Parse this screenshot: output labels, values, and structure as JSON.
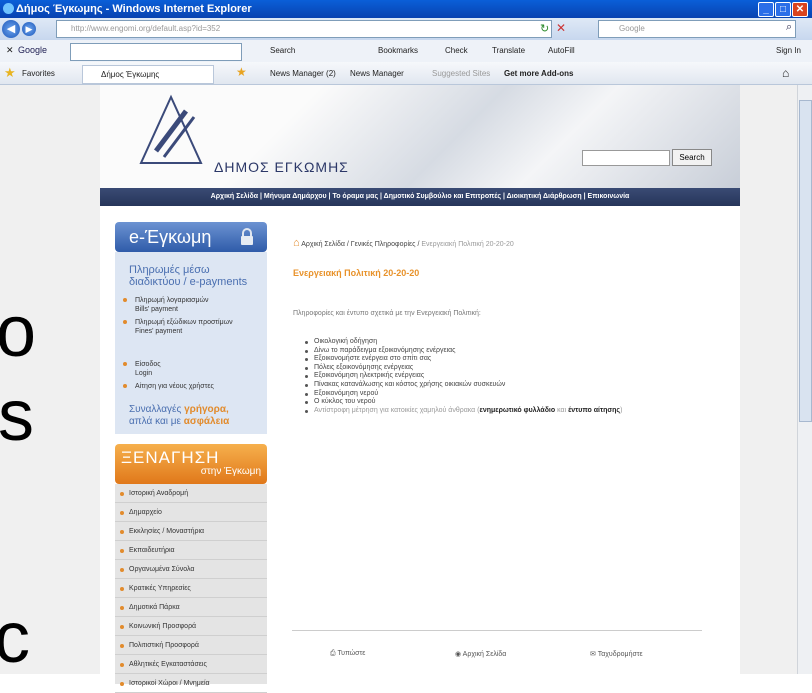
{
  "window": {
    "title": "Δήμος Έγκωμης - Windows Internet Explorer",
    "buttons": [
      "_",
      "□",
      "X"
    ]
  },
  "address_bar": {
    "url": "http://www.engomi.org/default.asp?id=352",
    "search_placeholder": "Google"
  },
  "google_toolbar": {
    "label": "Google",
    "items": [
      "Search",
      "Bookmarks",
      "Check",
      "Translate",
      "AutoFill"
    ],
    "right_items": [
      "Sign In"
    ]
  },
  "favorites_bar": {
    "favorites_label": "Favorites",
    "tab_label": "Δήμος Έγκωμης",
    "links": [
      "News Manager (2)",
      "News Manager",
      "Suggested Sites",
      "Get more Add-ons"
    ]
  },
  "site": {
    "municipality": "ΔΗΜΟΣ ΕΓΚΩΜΗΣ",
    "search_button": "Search",
    "nav_text": "Αρχική Σελίδα | Μήνυμα Δημάρχου | Το όραμα μας | Δημοτικό Συμβούλιο και Επιτροπές | Διοικητική Διάρθρωση | Επικοινωνία"
  },
  "eservices": {
    "title": "e-Έγκωμη",
    "subtitle": "Πληρωμές μέσω διαδικτύου / e-payments",
    "items": [
      {
        "label": "Πληρωμή λογαριασμών",
        "sub": "Bills' payment"
      },
      {
        "label": "Πληρωμή εξώδικων προστίμων",
        "sub": "Fines' payment"
      },
      {
        "label": "Είσοδος",
        "sub": "Login"
      },
      {
        "label": "Αίτηση για νέους χρήστες",
        "sub": ""
      }
    ],
    "tagline1": "Συναλλαγές",
    "tagline2": "γρήγορα,",
    "tagline3": "απλά και με",
    "tagline4": "ασφάλεια"
  },
  "xenagisi": {
    "title": "ΞΕΝΑΓΗΣΗ",
    "subtitle": "στην Έγκωμη",
    "items": [
      "Ιστορική Αναδρομή",
      "Δημαρχείο",
      "Εκκλησίες / Μοναστήρια",
      "Εκπαιδευτήρια",
      "Οργανωμένα Σύνολα",
      "Κρατικές Υπηρεσίες",
      "Δημοτικά Πάρκα",
      "Κοινωνική Προσφορά",
      "Πολιτιστική Προσφορά",
      "Αθλητικές Εγκαταστάσεις",
      "Ιστορικοί Χώροι / Μνημεία"
    ]
  },
  "breadcrumb": {
    "home": "Αρχική Σελίδα",
    "sep": "/",
    "section": "Γενικές Πληροφορίες",
    "current": "Ενεργειακή Πολιτική 20-20-20"
  },
  "main": {
    "heading": "Ενεργειακή Πολιτική 20-20-20",
    "intro": "Πληροφορίες και έντυπο σχετικά με την Ενεργειακή Πολιτική:",
    "list": [
      "Οικολογική οδήγηση",
      "Δίνω το παράδειγμα εξοικονόμησης ενέργειας",
      "Εξοικονομήστε ενέργεια στο σπίτι σας",
      "Πόλεις εξοικονόμησης ενέργειας",
      "Εξοικονόμηση ηλεκτρικής ενέργειας",
      "Πίνακας κατανάλωσης και κόστος χρήσης οικιακών συσκευών",
      "Εξοικονόμηση νερού",
      "Ο κύκλος του νερού"
    ],
    "last_item": "Αντίστροφη μέτρηση για κατοικίες χαμηλού άνθρακα (",
    "last_bold1": "ενημερωτικό φυλλάδιο",
    "last_mid": " και ",
    "last_bold2": "έντυπο αίτησης",
    "last_end": ")"
  },
  "footer": {
    "print": "Τυπώστε",
    "home": "Αρχική Σελίδα",
    "mail": "Ταχυδρομήστε"
  },
  "slide_letters": [
    "o",
    "s",
    "c"
  ],
  "colors": {
    "accent_orange": "#e28b2c",
    "nav_blue": "#26355a",
    "heading_orange": "#e8922a"
  }
}
